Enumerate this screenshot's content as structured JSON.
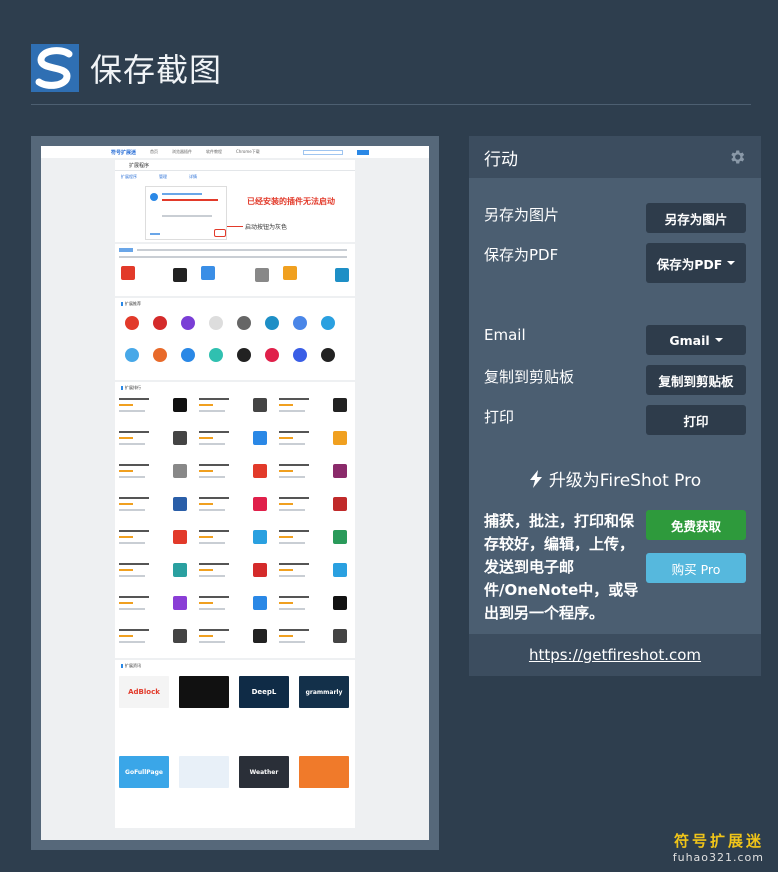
{
  "header": {
    "title": "保存截图"
  },
  "preview": {
    "site_name": "符号扩展迷",
    "nav": [
      "首页",
      "浏览器插件",
      "软件教程",
      "Chrome下载"
    ],
    "ext_label": "扩展程序",
    "tabs": [
      "扩展程序",
      "管理",
      "详情"
    ],
    "notice": "已经安装的插件无法启动",
    "hint": "启动按钮为灰色",
    "section_recommend": "扩展推荐",
    "section_hot": "扩展排行",
    "section_news": "扩展资讯",
    "tiles": [
      "AdBlock",
      "DeepL",
      "grammarly",
      "GoFullPage",
      "Weather"
    ]
  },
  "panel": {
    "title": "行动",
    "rows": [
      {
        "label": "另存为图片",
        "button": "另存为图片"
      },
      {
        "label": "保存为PDF",
        "button": "保存为PDF"
      },
      {
        "label": "Email",
        "button": "Gmail"
      },
      {
        "label": "复制到剪贴板",
        "button": "复制到剪贴板"
      },
      {
        "label": "打印",
        "button": "打印"
      }
    ],
    "upgrade": "升级为FireShot Pro",
    "promo": "捕获，批注，打印和保存较好，编辑，上传，发送到电子邮件/OneNote中，或导出到另一个程序。",
    "free_button": "免费获取",
    "buy_button": "购买 Pro",
    "link": "https://getfireshot.com"
  },
  "watermark": {
    "line1": "符号扩展迷",
    "line2": "fuhao321.com"
  },
  "colors": {
    "background": "#2e3e4e",
    "panel": "#4b5e71",
    "green": "#2e9a3c",
    "blue": "#56b8dd"
  }
}
